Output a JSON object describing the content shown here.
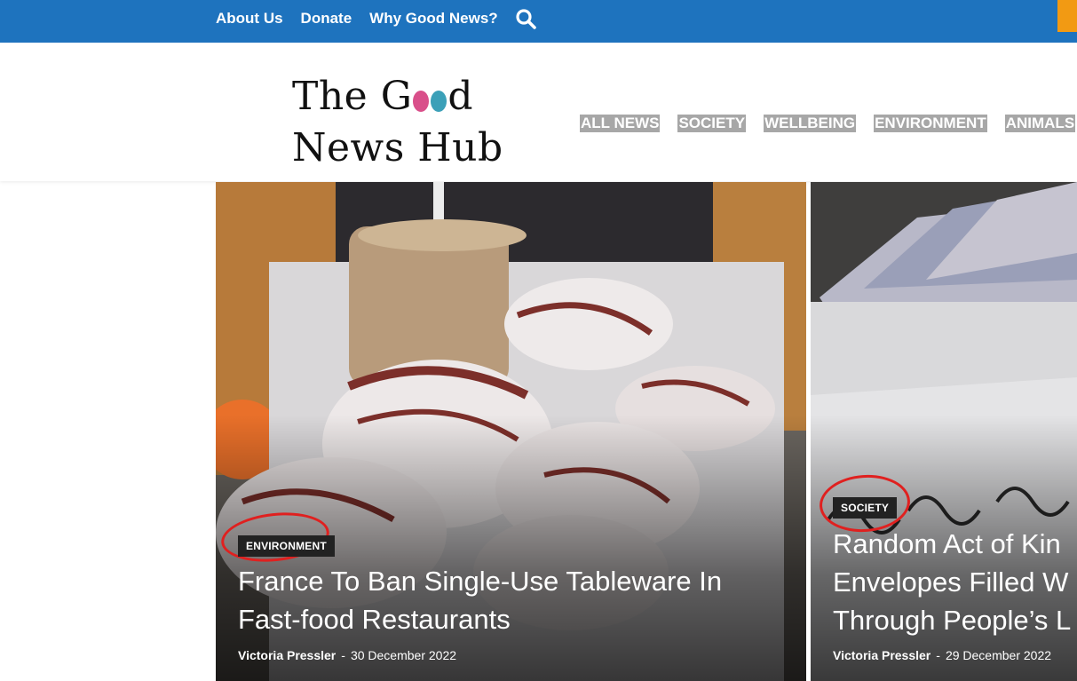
{
  "top_nav": {
    "items": [
      "About Us",
      "Donate",
      "Why Good News?"
    ],
    "search_icon": "search-icon"
  },
  "brand": {
    "line1_a": "The G",
    "line1_b": "d",
    "line2": "News Hub",
    "dot_colors": [
      "#d94f8a",
      "#3ba0b8"
    ]
  },
  "categories": [
    "ALL NEWS",
    "SOCIETY",
    "WELLBEING",
    "ENVIRONMENT",
    "ANIMALS"
  ],
  "articles": [
    {
      "category": "ENVIRONMENT",
      "title_line1": "France To Ban Single-Use Tableware In",
      "title_line2": "Fast-food Restaurants",
      "author": "Victoria Pressler",
      "separator": "-",
      "date": "30 December 2022",
      "image_icon": "hamburger-photo"
    },
    {
      "category": "SOCIETY",
      "title_line1": "Random Act of Kin",
      "title_line2": "Envelopes Filled W",
      "title_line3": "Through People’s L",
      "author": "Victoria Pressler",
      "separator": "-",
      "date": "29 December 2022",
      "image_icon": "envelope-money-photo"
    }
  ],
  "colors": {
    "topbar": "#1e73be",
    "accent_orange": "#f29a13",
    "annotation_red": "#e0201f"
  }
}
